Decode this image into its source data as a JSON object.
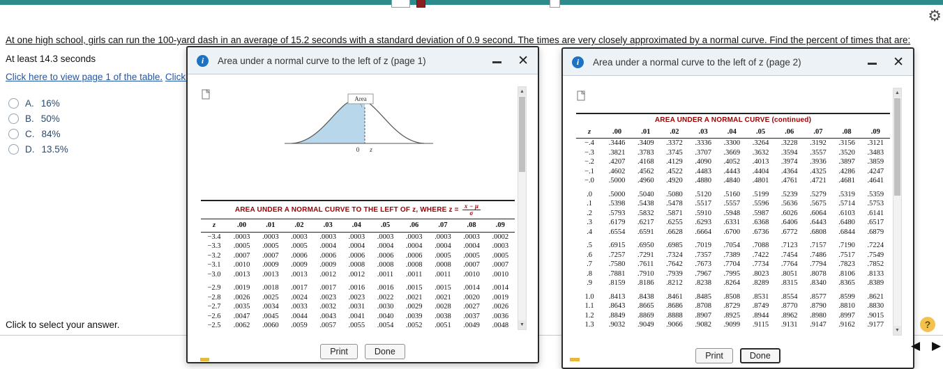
{
  "icons": {
    "gear": "⚙",
    "info": "i",
    "close": "✕",
    "scroll_up": "▲",
    "scroll_down": "▼",
    "prev": "◀",
    "next": "▶",
    "help": "?"
  },
  "question": {
    "text": "At one high school, girls can run the 100-yard dash in an average of 15.2 seconds with a standard deviation of 0.9 second. The times are very closely approximated by a normal curve. Find the percent of times that are:",
    "sub_text": "At least 14.3 seconds",
    "link1": "Click here to view page 1 of the table.",
    "link2": "Click here",
    "options": [
      {
        "letter": "A.",
        "value": "16%"
      },
      {
        "letter": "B.",
        "value": "50%"
      },
      {
        "letter": "C.",
        "value": "84%"
      },
      {
        "letter": "D.",
        "value": "13.5%"
      }
    ],
    "footer": "Click to select your answer."
  },
  "dialog1": {
    "title": "Area under a normal curve to the left of z (page 1)",
    "curve": {
      "area_label": "Area",
      "axis_zero": "0",
      "axis_z": "z"
    },
    "table_title": "AREA UNDER A NORMAL CURVE TO THE LEFT OF z, WHERE z =",
    "formula_numerator": "x − μ",
    "formula_denominator": "σ",
    "print_label": "Print",
    "done_label": "Done",
    "table": {
      "headers": [
        "z",
        ".00",
        ".01",
        ".02",
        ".03",
        ".04",
        ".05",
        ".06",
        ".07",
        ".08",
        ".09"
      ],
      "row_groups": [
        [
          [
            "−3.4",
            ".0003",
            ".0003",
            ".0003",
            ".0003",
            ".0003",
            ".0003",
            ".0003",
            ".0003",
            ".0003",
            ".0002"
          ],
          [
            "−3.3",
            ".0005",
            ".0005",
            ".0005",
            ".0004",
            ".0004",
            ".0004",
            ".0004",
            ".0004",
            ".0004",
            ".0003"
          ],
          [
            "−3.2",
            ".0007",
            ".0007",
            ".0006",
            ".0006",
            ".0006",
            ".0006",
            ".0006",
            ".0005",
            ".0005",
            ".0005"
          ],
          [
            "−3.1",
            ".0010",
            ".0009",
            ".0009",
            ".0009",
            ".0008",
            ".0008",
            ".0008",
            ".0008",
            ".0007",
            ".0007"
          ],
          [
            "−3.0",
            ".0013",
            ".0013",
            ".0013",
            ".0012",
            ".0012",
            ".0011",
            ".0011",
            ".0011",
            ".0010",
            ".0010"
          ]
        ],
        [
          [
            "−2.9",
            ".0019",
            ".0018",
            ".0017",
            ".0017",
            ".0016",
            ".0016",
            ".0015",
            ".0015",
            ".0014",
            ".0014"
          ],
          [
            "−2.8",
            ".0026",
            ".0025",
            ".0024",
            ".0023",
            ".0023",
            ".0022",
            ".0021",
            ".0021",
            ".0020",
            ".0019"
          ],
          [
            "−2.7",
            ".0035",
            ".0034",
            ".0033",
            ".0032",
            ".0031",
            ".0030",
            ".0029",
            ".0028",
            ".0027",
            ".0026"
          ],
          [
            "−2.6",
            ".0047",
            ".0045",
            ".0044",
            ".0043",
            ".0041",
            ".0040",
            ".0039",
            ".0038",
            ".0037",
            ".0036"
          ],
          [
            "−2.5",
            ".0062",
            ".0060",
            ".0059",
            ".0057",
            ".0055",
            ".0054",
            ".0052",
            ".0051",
            ".0049",
            ".0048"
          ]
        ]
      ]
    }
  },
  "dialog2": {
    "title": "Area under a normal curve to the left of z (page 2)",
    "table_title": "AREA UNDER A NORMAL CURVE (continued)",
    "print_label": "Print",
    "done_label": "Done",
    "table": {
      "headers": [
        "z",
        ".00",
        ".01",
        ".02",
        ".03",
        ".04",
        ".05",
        ".06",
        ".07",
        ".08",
        ".09"
      ],
      "row_groups": [
        [
          [
            "−.4",
            ".3446",
            ".3409",
            ".3372",
            ".3336",
            ".3300",
            ".3264",
            ".3228",
            ".3192",
            ".3156",
            ".3121"
          ],
          [
            "−.3",
            ".3821",
            ".3783",
            ".3745",
            ".3707",
            ".3669",
            ".3632",
            ".3594",
            ".3557",
            ".3520",
            ".3483"
          ],
          [
            "−.2",
            ".4207",
            ".4168",
            ".4129",
            ".4090",
            ".4052",
            ".4013",
            ".3974",
            ".3936",
            ".3897",
            ".3859"
          ],
          [
            "−.1",
            ".4602",
            ".4562",
            ".4522",
            ".4483",
            ".4443",
            ".4404",
            ".4364",
            ".4325",
            ".4286",
            ".4247"
          ],
          [
            "−.0",
            ".5000",
            ".4960",
            ".4920",
            ".4880",
            ".4840",
            ".4801",
            ".4761",
            ".4721",
            ".4681",
            ".4641"
          ]
        ],
        [
          [
            ".0",
            ".5000",
            ".5040",
            ".5080",
            ".5120",
            ".5160",
            ".5199",
            ".5239",
            ".5279",
            ".5319",
            ".5359"
          ],
          [
            ".1",
            ".5398",
            ".5438",
            ".5478",
            ".5517",
            ".5557",
            ".5596",
            ".5636",
            ".5675",
            ".5714",
            ".5753"
          ],
          [
            ".2",
            ".5793",
            ".5832",
            ".5871",
            ".5910",
            ".5948",
            ".5987",
            ".6026",
            ".6064",
            ".6103",
            ".6141"
          ],
          [
            ".3",
            ".6179",
            ".6217",
            ".6255",
            ".6293",
            ".6331",
            ".6368",
            ".6406",
            ".6443",
            ".6480",
            ".6517"
          ],
          [
            ".4",
            ".6554",
            ".6591",
            ".6628",
            ".6664",
            ".6700",
            ".6736",
            ".6772",
            ".6808",
            ".6844",
            ".6879"
          ]
        ],
        [
          [
            ".5",
            ".6915",
            ".6950",
            ".6985",
            ".7019",
            ".7054",
            ".7088",
            ".7123",
            ".7157",
            ".7190",
            ".7224"
          ],
          [
            ".6",
            ".7257",
            ".7291",
            ".7324",
            ".7357",
            ".7389",
            ".7422",
            ".7454",
            ".7486",
            ".7517",
            ".7549"
          ],
          [
            ".7",
            ".7580",
            ".7611",
            ".7642",
            ".7673",
            ".7704",
            ".7734",
            ".7764",
            ".7794",
            ".7823",
            ".7852"
          ],
          [
            ".8",
            ".7881",
            ".7910",
            ".7939",
            ".7967",
            ".7995",
            ".8023",
            ".8051",
            ".8078",
            ".8106",
            ".8133"
          ],
          [
            ".9",
            ".8159",
            ".8186",
            ".8212",
            ".8238",
            ".8264",
            ".8289",
            ".8315",
            ".8340",
            ".8365",
            ".8389"
          ]
        ],
        [
          [
            "1.0",
            ".8413",
            ".8438",
            ".8461",
            ".8485",
            ".8508",
            ".8531",
            ".8554",
            ".8577",
            ".8599",
            ".8621"
          ],
          [
            "1.1",
            ".8643",
            ".8665",
            ".8686",
            ".8708",
            ".8729",
            ".8749",
            ".8770",
            ".8790",
            ".8810",
            ".8830"
          ],
          [
            "1.2",
            ".8849",
            ".8869",
            ".8888",
            ".8907",
            ".8925",
            ".8944",
            ".8962",
            ".8980",
            ".8997",
            ".9015"
          ],
          [
            "1.3",
            ".9032",
            ".9049",
            ".9066",
            ".9082",
            ".9099",
            ".9115",
            ".9131",
            ".9147",
            ".9162",
            ".9177"
          ]
        ]
      ]
    }
  }
}
